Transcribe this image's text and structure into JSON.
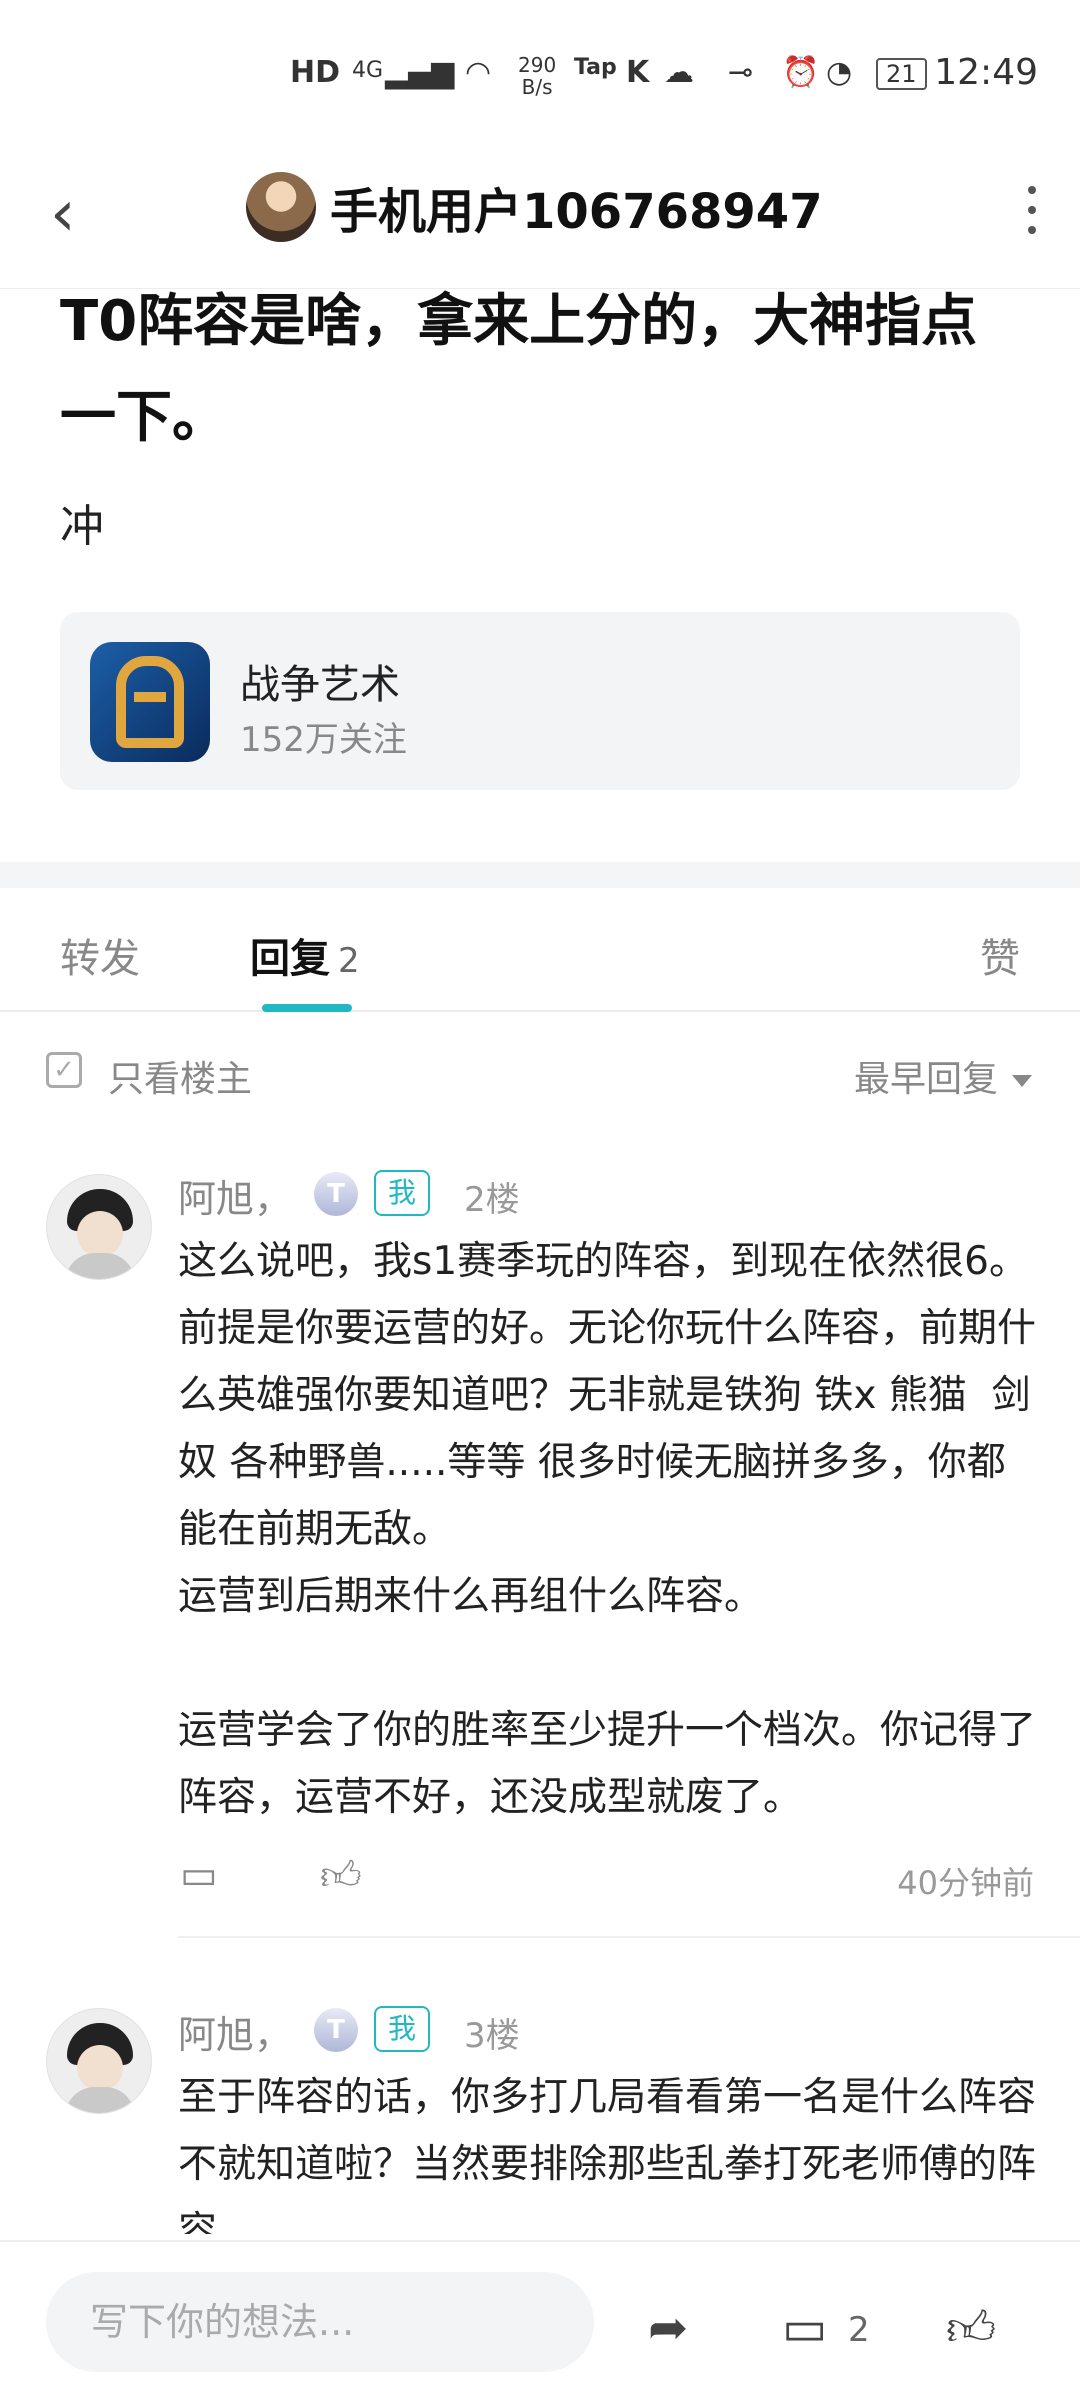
{
  "status_bar": {
    "hd": "HD",
    "sim": "4G",
    "speed": "290\nB/s",
    "tap": "Tap",
    "battery": "21",
    "time": "12:49"
  },
  "header": {
    "title": "手机用户106768947"
  },
  "post": {
    "title": "T0阵容是啥，拿来上分的，大神指点一下。",
    "body": "冲"
  },
  "game": {
    "name": "战争艺术",
    "followers": "152万关注"
  },
  "tabs": {
    "forward": "转发",
    "reply": "回复",
    "reply_count": "2",
    "like": "赞"
  },
  "filter": {
    "only_op": "只看楼主",
    "sort": "最早回复"
  },
  "comments": [
    {
      "name": "阿旭，",
      "badge": "T",
      "me": "我",
      "floor": "2楼",
      "text": "这么说吧，我s1赛季玩的阵容，到现在依然很6。前提是你要运营的好。无论你玩什么阵容，前期什么英雄强你要知道吧？无非就是铁狗 铁x 熊猫  剑奴 各种野兽.....等等 很多时候无脑拼多多，你都能在前期无敌。\n运营到后期来什么再组什么阵容。\n\n运营学会了你的胜率至少提升一个档次。你记得了阵容，运营不好，还没成型就废了。",
      "time": "40分钟前"
    },
    {
      "name": "阿旭，",
      "badge": "T",
      "me": "我",
      "floor": "3楼",
      "text": "至于阵容的话，你多打几局看看第一名是什么阵容不就知道啦？当然要排除那些乱拳打死老师傅的阵容"
    }
  ],
  "bottom_bar": {
    "input_placeholder": "写下你的想法...",
    "comment_count": "2"
  },
  "icons": [
    "back-icon",
    "more-icon",
    "share-icon",
    "comment-icon",
    "thumb-up-icon",
    "checkbox-icon",
    "dropdown-icon"
  ],
  "colors": {
    "accent": "#1fb8c3",
    "muted": "#888888",
    "card_bg": "#f3f4f6"
  }
}
